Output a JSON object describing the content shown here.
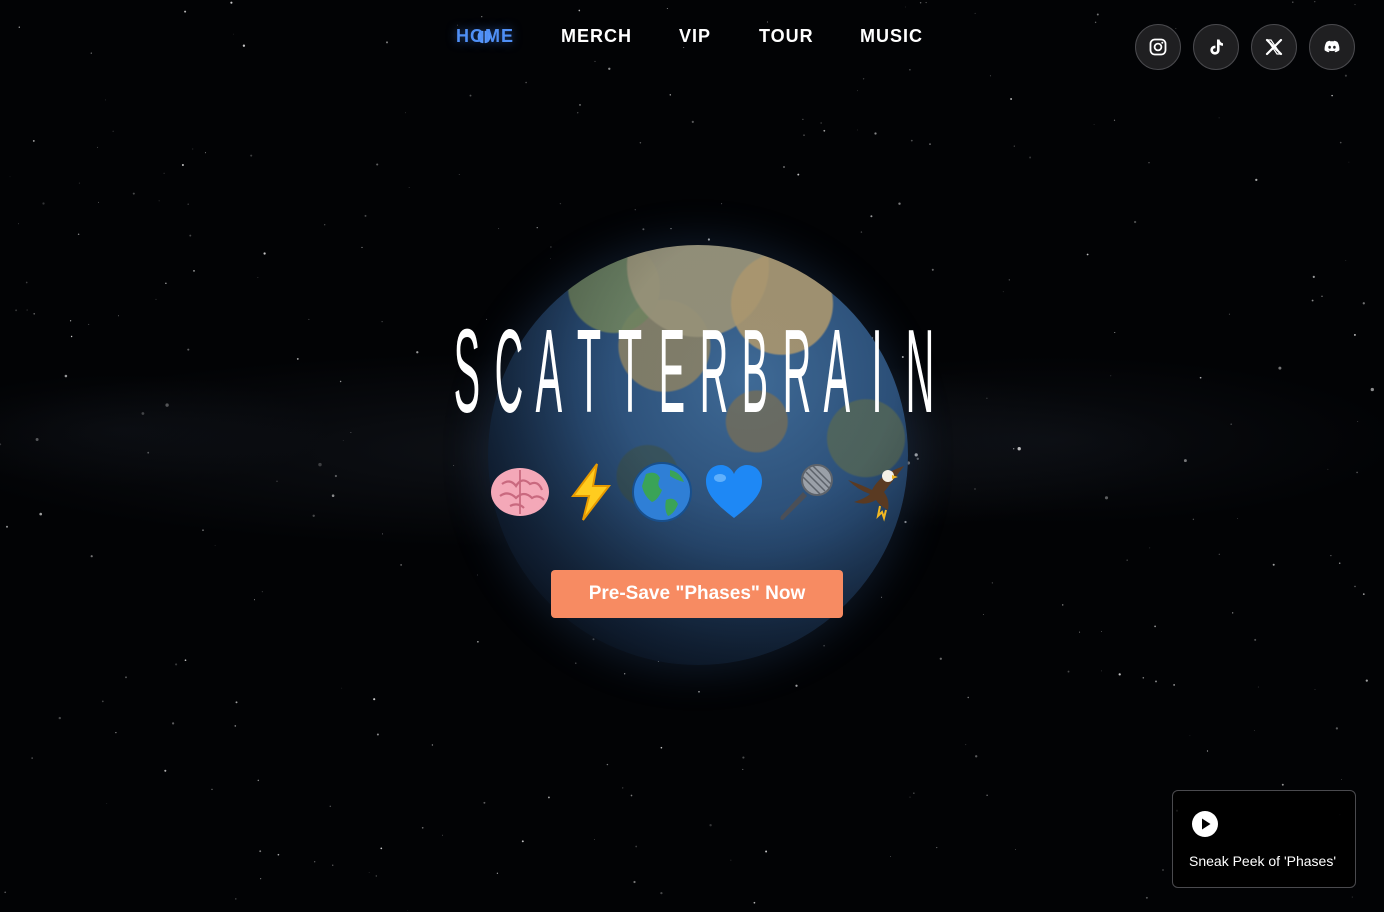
{
  "nav": {
    "items": [
      {
        "label": "HOME",
        "active": true
      },
      {
        "label": "MERCH",
        "active": false
      },
      {
        "label": "VIP",
        "active": false
      },
      {
        "label": "TOUR",
        "active": false
      },
      {
        "label": "MUSIC",
        "active": false
      }
    ],
    "active_color": "#4f8ff5"
  },
  "socials": [
    {
      "icon": "instagram-icon"
    },
    {
      "icon": "tiktok-icon"
    },
    {
      "icon": "x-icon"
    },
    {
      "icon": "discord-icon"
    }
  ],
  "hero": {
    "title": "SCATTERBRAIN",
    "emojis": [
      "🧠",
      "⚡",
      "🌎",
      "💙",
      "🎤",
      "🦅"
    ],
    "cta_label": "Pre-Save \"Phases\" Now",
    "cta_color": "#f78b62"
  },
  "sneak_peek": {
    "label": "Sneak Peek of 'Phases'",
    "icon": "play-icon"
  }
}
